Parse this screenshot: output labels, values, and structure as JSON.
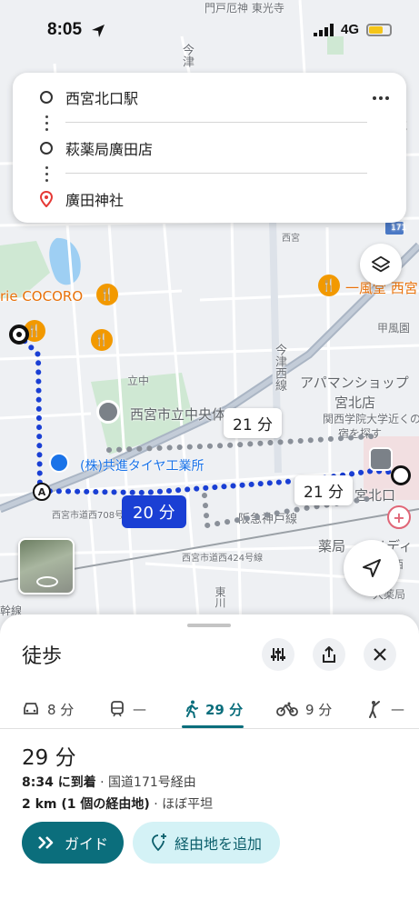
{
  "status": {
    "time": "8:05",
    "network": "4G",
    "battery_level": 0.7
  },
  "route": {
    "stops": [
      "西宮北口駅",
      "萩薬局廣田店",
      "廣田神社"
    ]
  },
  "map": {
    "labels": {
      "ichou": "門戸厄神 東光寺",
      "cocoro": "rie COCORO",
      "ifu": "一風堂 西宮",
      "koufu": "甲風園",
      "school": "西宮市立中央体",
      "tire": "(株)共進タイヤ工業所",
      "apaman": "アパマンショップ",
      "miyakita": "宮北店",
      "kangaku": "関西学院大学近くの",
      "yado": "宿を探す",
      "miyakitaguchi": "宮北口",
      "hankyu": "阪急神戸線",
      "road708": "西宮市道西708号線",
      "road424": "西宮市道西424号線",
      "imazu": "今津西線",
      "imazu2": "今津",
      "yakkyoku": "薬局",
      "medi": "メディ",
      "kansai": "関西",
      "kan": "幹線",
      "higashi": "東川",
      "tate": "立中",
      "yaku2": "大薬局",
      "route171": "171",
      "marker_a": "A",
      "nishimiya_kita": "西宮",
      "north_ward": "西宮北",
      "byou": "厄"
    },
    "durations": {
      "alt1": "21 分",
      "selected": "20 分",
      "alt2": "21 分"
    }
  },
  "sheet": {
    "title": "徒歩",
    "modes": [
      {
        "name": "car",
        "label": "8 分"
      },
      {
        "name": "transit",
        "label": "—"
      },
      {
        "name": "walk",
        "label": "29 分"
      },
      {
        "name": "bike",
        "label": "9 分"
      },
      {
        "name": "ride",
        "label": "—"
      }
    ],
    "duration": "29 分",
    "arrival": "8:34 に到着",
    "via": " · 国道171号経由",
    "distance": "2 km (1 個の経由地)",
    "terrain": " · ほぼ平坦",
    "guide_label": "ガイド",
    "add_stop_label": "経由地を追加"
  }
}
